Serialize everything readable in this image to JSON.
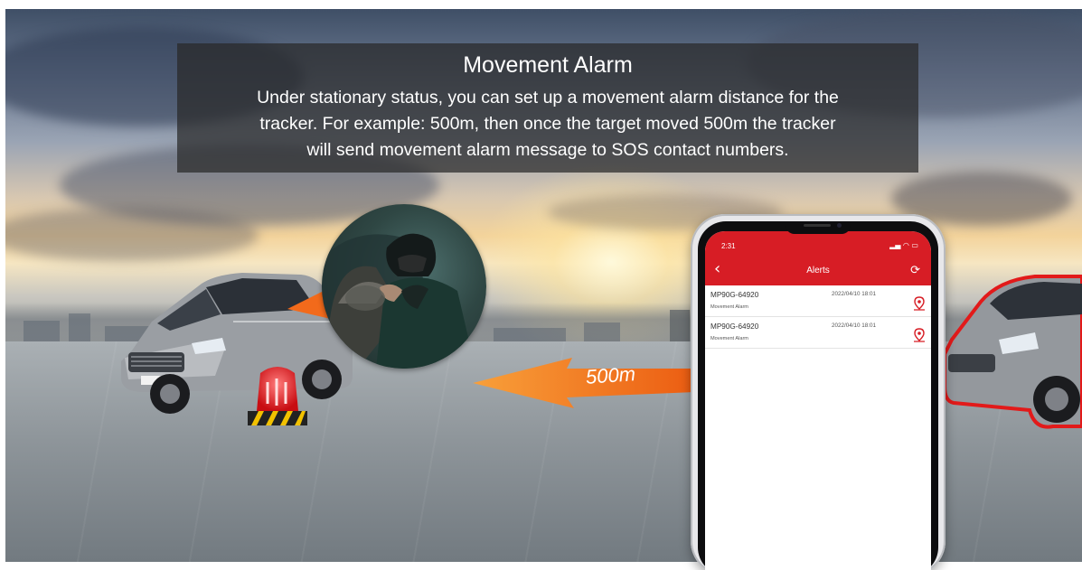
{
  "banner": {
    "title": "Movement Alarm",
    "lines": [
      "Under stationary status, you can set up a movement alarm distance for the",
      "tracker.  For example: 500m, then once the target moved 500m the tracker",
      "will send movement alarm message to SOS contact numbers."
    ]
  },
  "distance_label": "500m",
  "phone": {
    "status_time": "2:31",
    "status_icons": "▂▄ ◠ ▭",
    "back_icon": "‹",
    "title": "Alerts",
    "refresh_icon": "⟳",
    "alerts": [
      {
        "device": "MP90G-64920",
        "time": "2022/04/10 18:01",
        "type": "Movement Alarm"
      },
      {
        "device": "MP90G-64920",
        "time": "2022/04/10 18:01",
        "type": "Movement Alarm"
      }
    ]
  },
  "colors": {
    "brand_red": "#d71d25",
    "arrow_orange": "#f26a1b",
    "banner_bg": "#282828"
  },
  "icons": [
    "back-chevron-icon",
    "refresh-icon",
    "map-pin-icon",
    "alarm-siren-icon"
  ]
}
